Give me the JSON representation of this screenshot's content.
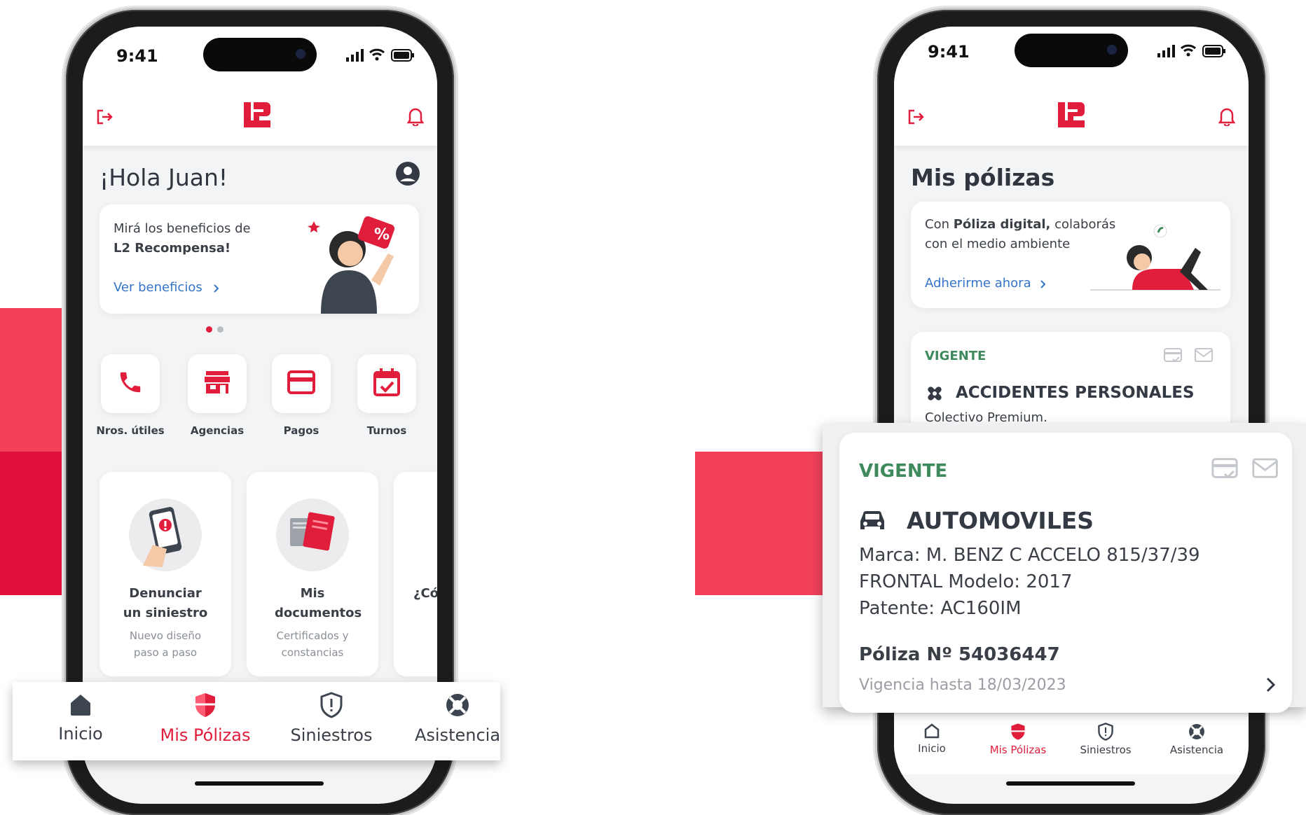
{
  "colors": {
    "brand_red": "#e01e3c",
    "accent_pink": "#f2405a",
    "link_blue": "#3474c9",
    "status_green": "#3e8a5c",
    "background": "#f3f4f6"
  },
  "left_phone": {
    "status_time": "9:41",
    "greeting": "¡Hola Juan!",
    "promo": {
      "line1": "Mirá los beneficios de",
      "line2": "L2 Recompensa!",
      "link": "Ver beneficios",
      "badge_symbol": "%"
    },
    "quick_actions": [
      {
        "label": "Nros. útiles",
        "icon": "phone-icon"
      },
      {
        "label": "Agencias",
        "icon": "store-icon"
      },
      {
        "label": "Pagos",
        "icon": "credit-card-icon"
      },
      {
        "label": "Turnos",
        "icon": "calendar-check-icon"
      }
    ],
    "feature_cards": [
      {
        "title": "Denunciar un siniestro",
        "subtitle": "Nuevo diseño paso a paso"
      },
      {
        "title": "Mis documentos",
        "subtitle": "Certificados y constancias"
      },
      {
        "title": "¿Có",
        "subtitle": ""
      }
    ]
  },
  "bottom_nav": {
    "items": [
      {
        "label": "Inicio",
        "icon": "home-icon",
        "active": false
      },
      {
        "label": "Mis Pólizas",
        "icon": "shield-icon",
        "active": true
      },
      {
        "label": "Siniestros",
        "icon": "shield-alert-icon",
        "active": false
      },
      {
        "label": "Asistencia",
        "icon": "lifebuoy-icon",
        "active": false
      }
    ]
  },
  "right_phone": {
    "status_time": "9:41",
    "title": "Mis pólizas",
    "digital_banner": {
      "prefix": "Con ",
      "bold": "Póliza digital,",
      "suffix": " colaborás",
      "line2": "con el medio ambiente",
      "link": "Adherirme ahora"
    },
    "policies": [
      {
        "status": "VIGENTE",
        "category": "ACCIDENTES PERSONALES",
        "detail": "Colectivo Premium."
      }
    ],
    "expanded_policy": {
      "status": "VIGENTE",
      "category": "AUTOMOVILES",
      "brand_line": "Marca: M. BENZ C ACCELO 815/37/39",
      "model_line": "FRONTAL Modelo: 2017",
      "plate_line": "Patente: AC160IM",
      "policy_number": "Póliza Nº 54036447",
      "valid_until": "Vigencia hasta 18/03/2023"
    }
  }
}
